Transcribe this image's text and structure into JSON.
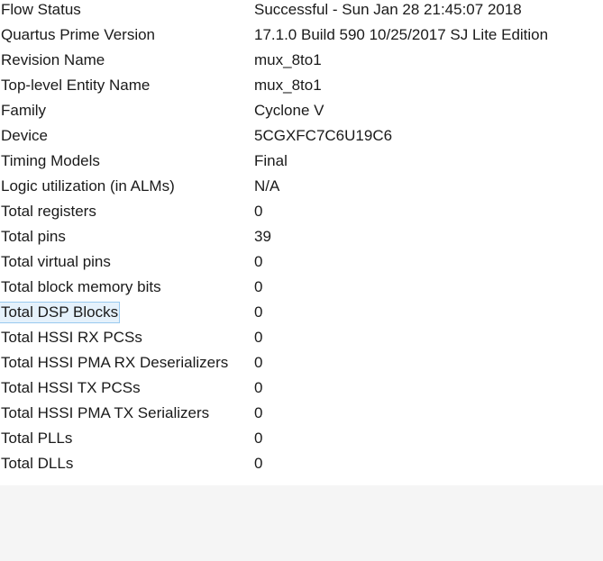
{
  "report": {
    "rows": [
      {
        "key": "Flow Status",
        "value": "Successful - Sun Jan 28 21:45:07 2018"
      },
      {
        "key": "Quartus Prime Version",
        "value": "17.1.0 Build 590 10/25/2017 SJ Lite Edition"
      },
      {
        "key": "Revision Name",
        "value": "mux_8to1"
      },
      {
        "key": "Top-level Entity Name",
        "value": "mux_8to1"
      },
      {
        "key": "Family",
        "value": "Cyclone V"
      },
      {
        "key": "Device",
        "value": "5CGXFC7C6U19C6"
      },
      {
        "key": "Timing Models",
        "value": "Final"
      },
      {
        "key": "Logic utilization (in ALMs)",
        "value": "N/A"
      },
      {
        "key": "Total registers",
        "value": "0"
      },
      {
        "key": "Total pins",
        "value": "39"
      },
      {
        "key": "Total virtual pins",
        "value": "0"
      },
      {
        "key": "Total block memory bits",
        "value": "0"
      },
      {
        "key": "Total DSP Blocks",
        "value": "0"
      },
      {
        "key": "Total HSSI RX PCSs",
        "value": "0"
      },
      {
        "key": "Total HSSI PMA RX Deserializers",
        "value": "0"
      },
      {
        "key": "Total HSSI TX PCSs",
        "value": "0"
      },
      {
        "key": "Total HSSI PMA TX Serializers",
        "value": "0"
      },
      {
        "key": "Total PLLs",
        "value": "0"
      },
      {
        "key": "Total DLLs",
        "value": "0"
      }
    ]
  },
  "colors": {
    "selection_background": "#e5f1fb",
    "selection_border": "#99c9ef",
    "empty_area": "#f5f5f5"
  }
}
